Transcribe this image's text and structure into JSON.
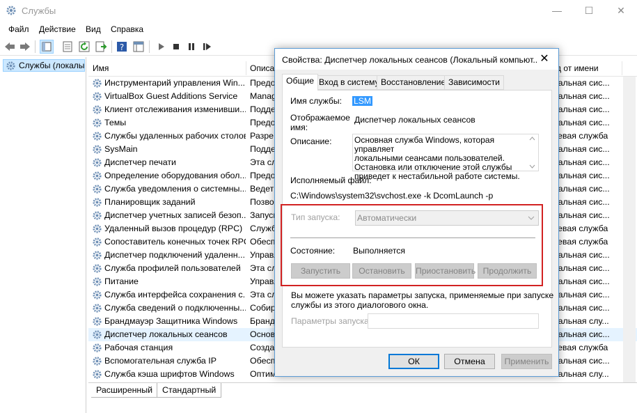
{
  "window": {
    "title": "Службы",
    "controls": {
      "minimize": "—",
      "maximize": "☐",
      "close": "✕"
    }
  },
  "menu": [
    "Файл",
    "Действие",
    "Вид",
    "Справка"
  ],
  "tree": {
    "item": "Службы (локалы"
  },
  "list": {
    "columns": {
      "name": "Имя",
      "desc": "Описа",
      "logon": "д от имени"
    },
    "rows": [
      {
        "name": "Инструментарий управления Win...",
        "desc": "Предо",
        "logon": "окальная сис..."
      },
      {
        "name": "VirtualBox Guest Additions Service",
        "desc": "Manag",
        "logon": "окальная сис..."
      },
      {
        "name": "Клиент отслеживания изменивши...",
        "desc": "Подде",
        "logon": "окальная сис..."
      },
      {
        "name": "Темы",
        "desc": "Предо",
        "logon": "окальная сис..."
      },
      {
        "name": "Службы удаленных рабочих столов",
        "desc": "Разре",
        "logon": "етевая служба"
      },
      {
        "name": "SysMain",
        "desc": "Подде",
        "logon": "окальная сис..."
      },
      {
        "name": "Диспетчер печати",
        "desc": "Эта сл",
        "logon": "окальная сис..."
      },
      {
        "name": "Определение оборудования обол...",
        "desc": "Предо",
        "logon": "окальная сис..."
      },
      {
        "name": "Служба уведомления о системны...",
        "desc": "Ведет ",
        "logon": "окальная сис..."
      },
      {
        "name": "Планировщик заданий",
        "desc": "Позво",
        "logon": "окальная сис..."
      },
      {
        "name": "Диспетчер учетных записей безоп...",
        "desc": "Запуск",
        "logon": "окальная сис..."
      },
      {
        "name": "Удаленный вызов процедур (RPC)",
        "desc": "Служб",
        "logon": "етевая служба"
      },
      {
        "name": "Сопоставитель конечных точек RPC",
        "desc": "Обесп",
        "logon": "етевая служба"
      },
      {
        "name": "Диспетчер подключений удаленн...",
        "desc": "Управл",
        "logon": "окальная сис..."
      },
      {
        "name": "Служба профилей пользователей",
        "desc": "Эта сл",
        "logon": "окальная сис..."
      },
      {
        "name": "Питание",
        "desc": "Управл",
        "logon": "окальная сис..."
      },
      {
        "name": "Служба интерфейса сохранения с...",
        "desc": "Эта сл",
        "logon": "окальная сис..."
      },
      {
        "name": "Служба сведений о подключенны...",
        "desc": "Собир",
        "logon": "окальная сис..."
      },
      {
        "name": "Брандмауэр Защитника Windows",
        "desc": "Бранд",
        "logon": "окальная слу..."
      },
      {
        "name": "Диспетчер локальных сеансов",
        "desc": "Основ",
        "logon": "окальная сис..."
      },
      {
        "name": "Рабочая станция",
        "desc": "Созда",
        "logon": "етевая служба"
      },
      {
        "name": "Вспомогательная служба IP",
        "desc": "Обесп",
        "logon": "окальная сис..."
      },
      {
        "name": "Служба кэша шрифтов Windows",
        "desc": "Оптими",
        "logon": "окальная слу..."
      }
    ]
  },
  "bottom_tabs": [
    "Расширенный",
    "Стандартный"
  ],
  "dialog": {
    "title": "Свойства: Диспетчер локальных сеансов (Локальный компьют...",
    "close": "✕",
    "tabs": [
      "Общие",
      "Вход в систему",
      "Восстановление",
      "Зависимости"
    ],
    "service_name_label": "Имя службы:",
    "service_name_value": "LSM",
    "display_name_label_1": "Отображаемое",
    "display_name_label_2": "имя:",
    "display_name_value": "Диспетчер локальных сеансов",
    "description_label": "Описание:",
    "description_lines": [
      "Основная служба Windows, которая управляет",
      "локальными сеансами пользователей.",
      "Остановка или отключение этой службы",
      "приведет к нестабильной работе системы."
    ],
    "exec_label": "Исполняемый файл:",
    "exec_path": "C:\\Windows\\system32\\svchost.exe -k DcomLaunch -p",
    "startup_type_label": "Тип запуска:",
    "startup_type_value": "Автоматически",
    "status_label": "Состояние:",
    "status_value": "Выполняется",
    "buttons": {
      "start": "Запустить",
      "stop": "Остановить",
      "pause": "Приостановить",
      "resume": "Продолжить"
    },
    "hint_line_1": "Вы можете указать параметры запуска, применяемые при запуске",
    "hint_line_2": "службы из этого диалогового окна.",
    "params_label": "Параметры запуска:",
    "params_value": "",
    "footer": {
      "ok": "ОК",
      "cancel": "Отмена",
      "apply": "Применить"
    }
  },
  "colors": {
    "highlight": "#3399ff",
    "selection_row": "#e5f3ff",
    "red_box": "#d22222",
    "accent": "#0078d7"
  }
}
